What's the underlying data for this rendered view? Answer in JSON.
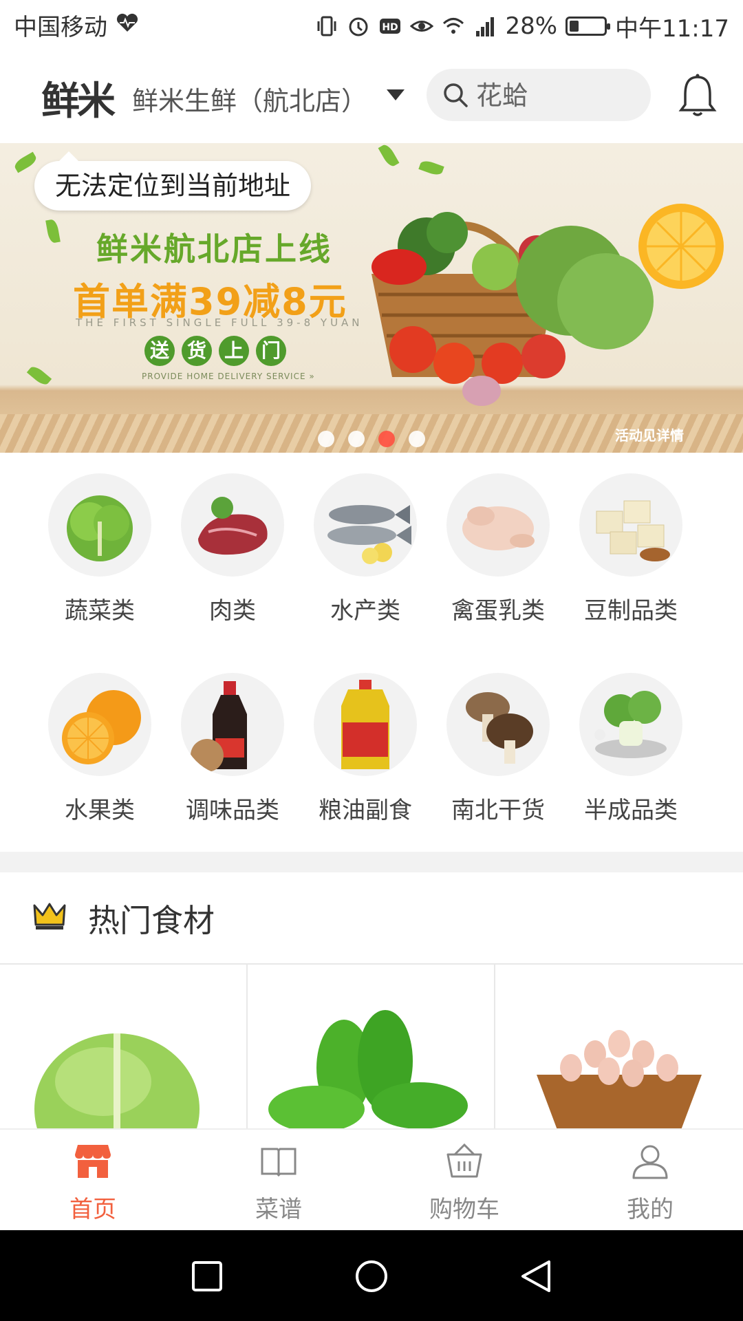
{
  "status_bar": {
    "carrier": "中国移动",
    "battery": "28%",
    "battery_level": 0.28,
    "time": "中午11:17",
    "icons": [
      "heart-icon",
      "vibrate-icon",
      "alarm-icon",
      "hd-icon",
      "eye-icon",
      "wifi-icon",
      "signal-icon",
      "battery-icon"
    ]
  },
  "header": {
    "logo": "鲜米",
    "store_name": "鲜米生鲜（航北店）",
    "search_placeholder": "花蛤"
  },
  "banner": {
    "location_tip": "无法定位到当前地址",
    "title": "鲜米航北店上线",
    "promo": "首单满39减8元",
    "promo_en": "THE FIRST SINGLE FULL 39-8 YUAN",
    "delivery_chars": [
      "送",
      "货",
      "上",
      "门"
    ],
    "delivery_en": "PROVIDE HOME DELIVERY SERVICE »",
    "detail": "活动见详情",
    "dots": 4,
    "active_dot": 2
  },
  "categories": [
    {
      "label": "蔬菜类",
      "icon": "vegetable-icon"
    },
    {
      "label": "肉类",
      "icon": "meat-icon"
    },
    {
      "label": "水产类",
      "icon": "fish-icon"
    },
    {
      "label": "禽蛋乳类",
      "icon": "poultry-icon"
    },
    {
      "label": "豆制品类",
      "icon": "tofu-icon"
    },
    {
      "label": "水果类",
      "icon": "orange-icon"
    },
    {
      "label": "调味品类",
      "icon": "soy-sauce-icon"
    },
    {
      "label": "粮油副食",
      "icon": "oil-icon"
    },
    {
      "label": "南北干货",
      "icon": "mushroom-icon"
    },
    {
      "label": "半成品类",
      "icon": "bok-choy-icon"
    }
  ],
  "hot_section": {
    "title": "热门食材",
    "products": [
      {
        "icon": "cabbage-icon"
      },
      {
        "icon": "spinach-icon"
      },
      {
        "icon": "eggs-icon"
      }
    ]
  },
  "bottom_nav": [
    {
      "label": "首页",
      "icon": "home-icon",
      "active": true
    },
    {
      "label": "菜谱",
      "icon": "book-icon",
      "active": false
    },
    {
      "label": "购物车",
      "icon": "basket-icon",
      "active": false
    },
    {
      "label": "我的",
      "icon": "user-icon",
      "active": false
    }
  ],
  "colors": {
    "accent": "#f2603e",
    "banner_green": "#66a82a",
    "banner_orange": "#f2a018",
    "active_dot": "#ff5040"
  }
}
